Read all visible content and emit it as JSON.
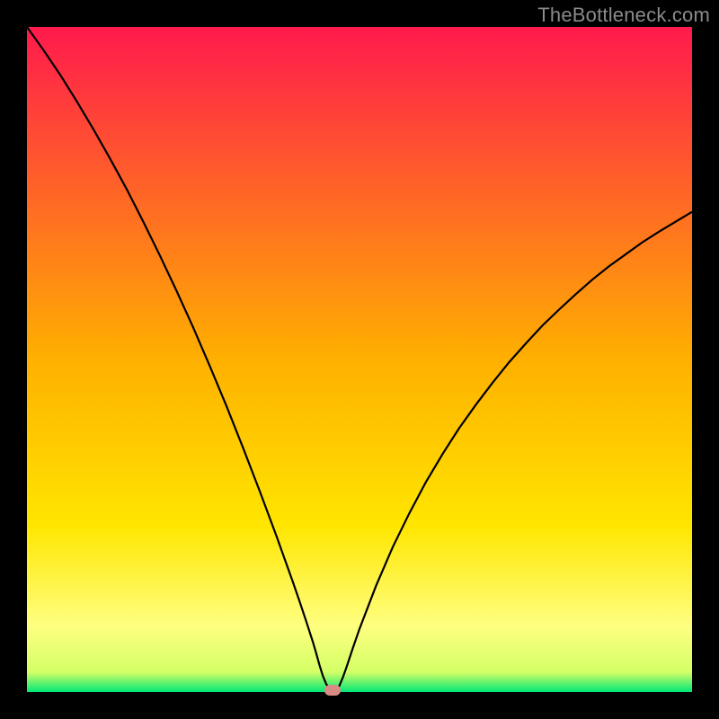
{
  "watermark": {
    "text": "TheBottleneck.com"
  },
  "colors": {
    "top": "#ff1a4d",
    "mid": "#ffd400",
    "low": "#ffff66",
    "base": "#00e676",
    "curve": "#000000",
    "marker": "#d98a85",
    "frame": "#000000"
  },
  "chart_data": {
    "type": "line",
    "title": "",
    "xlabel": "",
    "ylabel": "",
    "xlim": [
      0,
      1
    ],
    "ylim": [
      0,
      1
    ],
    "x": [
      0.0,
      0.025,
      0.05,
      0.075,
      0.1,
      0.125,
      0.15,
      0.175,
      0.2,
      0.225,
      0.25,
      0.275,
      0.3,
      0.325,
      0.35,
      0.375,
      0.4,
      0.41,
      0.42,
      0.43,
      0.435,
      0.44,
      0.445,
      0.45,
      0.455,
      0.46,
      0.465,
      0.47,
      0.475,
      0.48,
      0.49,
      0.5,
      0.525,
      0.55,
      0.575,
      0.6,
      0.625,
      0.65,
      0.675,
      0.7,
      0.725,
      0.75,
      0.775,
      0.8,
      0.825,
      0.85,
      0.875,
      0.9,
      0.925,
      0.95,
      0.975,
      1.0
    ],
    "values": [
      1.0,
      0.965,
      0.928,
      0.888,
      0.846,
      0.802,
      0.756,
      0.707,
      0.656,
      0.603,
      0.548,
      0.49,
      0.43,
      0.367,
      0.302,
      0.235,
      0.165,
      0.136,
      0.106,
      0.075,
      0.058,
      0.04,
      0.024,
      0.012,
      0.004,
      0.0,
      0.002,
      0.01,
      0.022,
      0.036,
      0.066,
      0.095,
      0.16,
      0.218,
      0.269,
      0.316,
      0.358,
      0.397,
      0.432,
      0.465,
      0.496,
      0.524,
      0.551,
      0.575,
      0.598,
      0.62,
      0.64,
      0.658,
      0.676,
      0.692,
      0.707,
      0.722
    ],
    "minimum_marker": {
      "x": 0.46,
      "y": 0.0
    },
    "gradient_stops": [
      {
        "offset": 0.0,
        "color": "#ff1a4d"
      },
      {
        "offset": 0.5,
        "color": "#ffb000"
      },
      {
        "offset": 0.75,
        "color": "#ffe600"
      },
      {
        "offset": 0.9,
        "color": "#ffff80"
      },
      {
        "offset": 0.97,
        "color": "#d4ff66"
      },
      {
        "offset": 1.0,
        "color": "#00e676"
      }
    ]
  }
}
